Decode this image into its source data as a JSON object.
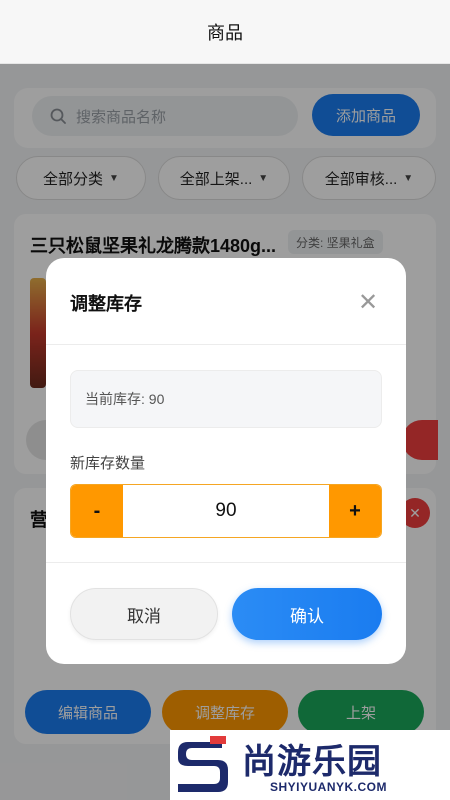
{
  "header": {
    "title": "商品"
  },
  "search": {
    "placeholder": "搜索商品名称",
    "add_label": "添加商品"
  },
  "filters": [
    "全部分类",
    "全部上架...",
    "全部审核..."
  ],
  "product1": {
    "title": "三只松鼠坚果礼龙腾款1480g...",
    "category": "分类: 坚果礼盒"
  },
  "product2": {
    "title_fragment": "营"
  },
  "actions": {
    "edit": "编辑商品",
    "adjust": "调整库存",
    "shelf": "上架"
  },
  "modal": {
    "title": "调整库存",
    "current_stock_text": "当前库存: 90",
    "new_label": "新库存数量",
    "minus": "-",
    "value": "90",
    "plus": "+",
    "cancel": "取消",
    "confirm": "确认"
  },
  "watermark": {
    "name": "尚游乐园",
    "url": "SHYIYUANYK.COM"
  },
  "colors": {
    "primary": "#1a7cf0",
    "accent_orange": "#ff9800",
    "danger": "#ef3e3e",
    "success": "#1aa85b"
  }
}
